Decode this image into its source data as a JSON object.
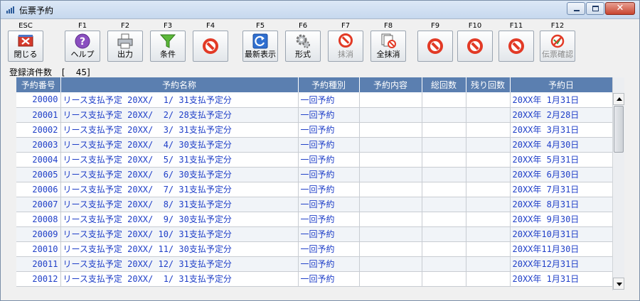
{
  "window": {
    "title": "伝票予約"
  },
  "toolbar": {
    "buttons": [
      {
        "key": "ESC",
        "label": "閉じる",
        "icon": "close-icon"
      },
      {
        "key": "F1",
        "label": "ヘルプ",
        "icon": "help-icon"
      },
      {
        "key": "F2",
        "label": "出力",
        "icon": "printer-icon"
      },
      {
        "key": "F3",
        "label": "条件",
        "icon": "filter-icon"
      },
      {
        "key": "F4",
        "label": "",
        "icon": "prohibited-icon"
      },
      {
        "key": "F5",
        "label": "最新表示",
        "icon": "refresh-icon"
      },
      {
        "key": "F6",
        "label": "形式",
        "icon": "gear-icon"
      },
      {
        "key": "F7",
        "label": "抹消",
        "icon": "delete-icon"
      },
      {
        "key": "F8",
        "label": "全抹消",
        "icon": "delete-all-icon"
      },
      {
        "key": "F9",
        "label": "",
        "icon": "prohibited-icon"
      },
      {
        "key": "F10",
        "label": "",
        "icon": "prohibited-icon"
      },
      {
        "key": "F11",
        "label": "",
        "icon": "prohibited-icon"
      },
      {
        "key": "F12",
        "label": "伝票確認",
        "icon": "slip-check-icon"
      }
    ]
  },
  "count": {
    "label": "登録済件数",
    "value": "[    45]"
  },
  "table": {
    "columns": [
      "予約番号",
      "予約名称",
      "予約種別",
      "予約内容",
      "総回数",
      "残り回数",
      "予約日"
    ],
    "rows": [
      [
        "20000",
        "リース支払予定 20XX/  1/ 31支払予定分",
        "一回予約",
        "",
        "",
        "",
        "20XX年 1月31日"
      ],
      [
        "20001",
        "リース支払予定 20XX/  2/ 28支払予定分",
        "一回予約",
        "",
        "",
        "",
        "20XX年 2月28日"
      ],
      [
        "20002",
        "リース支払予定 20XX/  3/ 31支払予定分",
        "一回予約",
        "",
        "",
        "",
        "20XX年 3月31日"
      ],
      [
        "20003",
        "リース支払予定 20XX/  4/ 30支払予定分",
        "一回予約",
        "",
        "",
        "",
        "20XX年 4月30日"
      ],
      [
        "20004",
        "リース支払予定 20XX/  5/ 31支払予定分",
        "一回予約",
        "",
        "",
        "",
        "20XX年 5月31日"
      ],
      [
        "20005",
        "リース支払予定 20XX/  6/ 30支払予定分",
        "一回予約",
        "",
        "",
        "",
        "20XX年 6月30日"
      ],
      [
        "20006",
        "リース支払予定 20XX/  7/ 31支払予定分",
        "一回予約",
        "",
        "",
        "",
        "20XX年 7月31日"
      ],
      [
        "20007",
        "リース支払予定 20XX/  8/ 31支払予定分",
        "一回予約",
        "",
        "",
        "",
        "20XX年 8月31日"
      ],
      [
        "20008",
        "リース支払予定 20XX/  9/ 30支払予定分",
        "一回予約",
        "",
        "",
        "",
        "20XX年 9月30日"
      ],
      [
        "20009",
        "リース支払予定 20XX/ 10/ 31支払予定分",
        "一回予約",
        "",
        "",
        "",
        "20XX年10月31日"
      ],
      [
        "20010",
        "リース支払予定 20XX/ 11/ 30支払予定分",
        "一回予約",
        "",
        "",
        "",
        "20XX年11月30日"
      ],
      [
        "20011",
        "リース支払予定 20XX/ 12/ 31支払予定分",
        "一回予約",
        "",
        "",
        "",
        "20XX年12月31日"
      ],
      [
        "20012",
        "リース支払予定 20XX/  1/ 31支払予定分",
        "一回予約",
        "",
        "",
        "",
        "20XX年 1月31日"
      ]
    ]
  }
}
